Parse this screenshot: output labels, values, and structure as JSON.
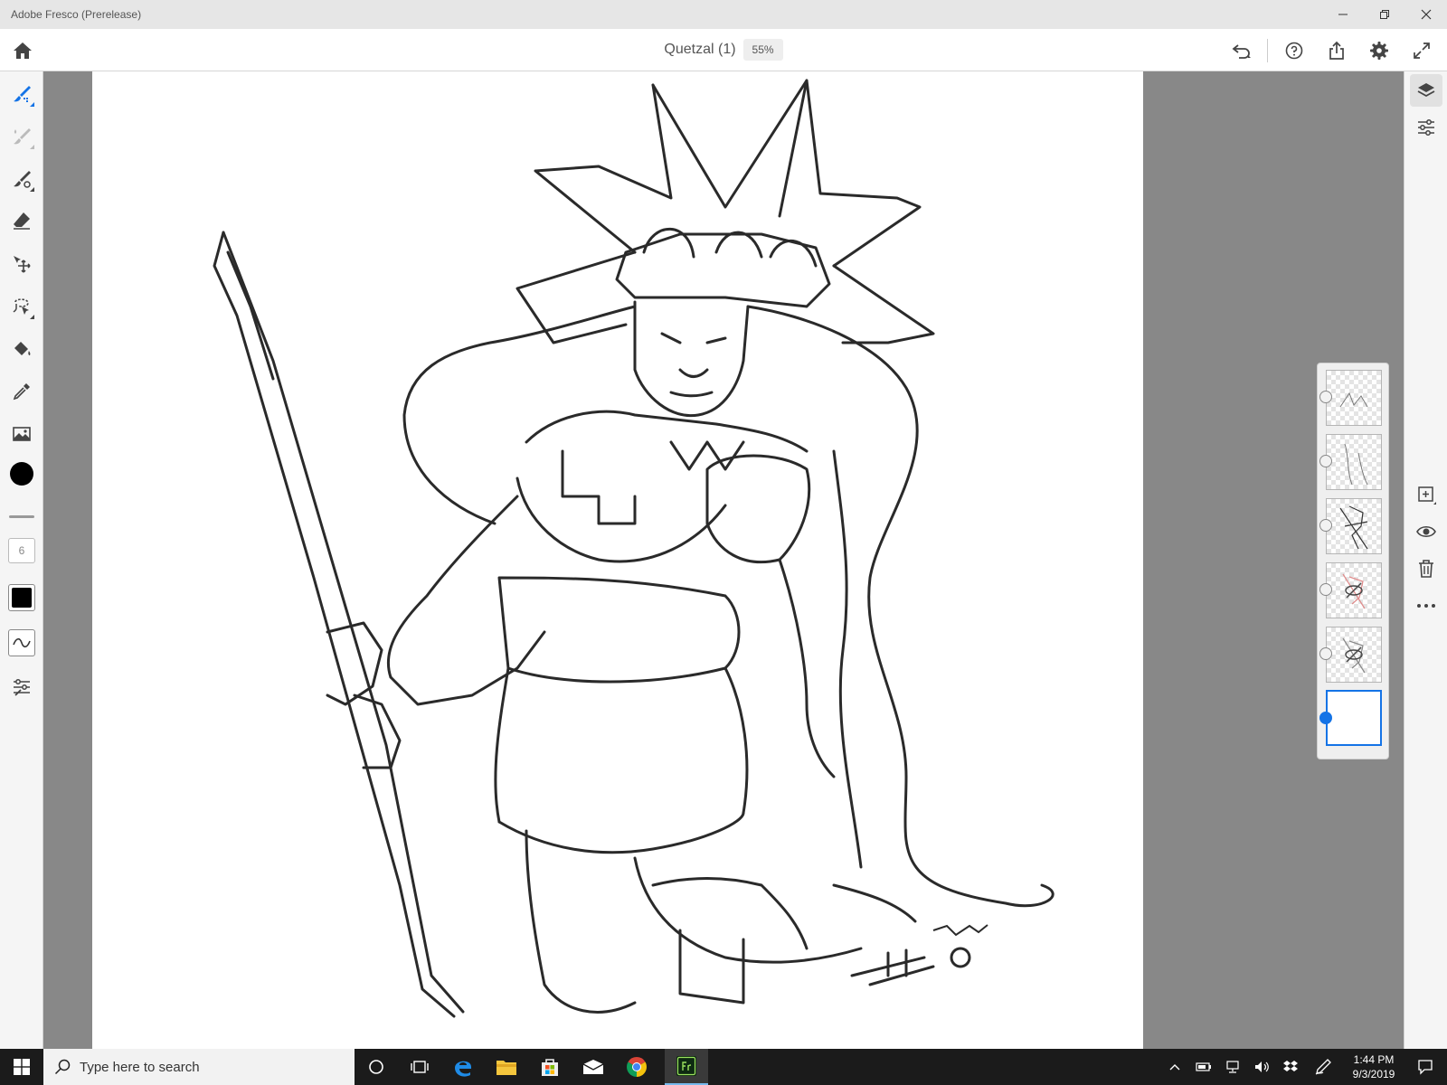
{
  "window": {
    "title": "Adobe Fresco (Prerelease)"
  },
  "header": {
    "document_name": "Quetzal (1)",
    "zoom": "55%"
  },
  "left_toolbar": {
    "tools": [
      "pixel-brush",
      "live-brush",
      "vector-brush",
      "eraser",
      "transform",
      "selection",
      "fill",
      "eyedropper",
      "image"
    ],
    "active_tool": "pixel-brush",
    "color": "#000000",
    "brush_size": "6"
  },
  "layers": {
    "count": 6,
    "selected_index": 5
  },
  "colors": {
    "accent": "#1473e6",
    "workspace": "#888888",
    "taskbar": "#1b1b1b"
  },
  "taskbar": {
    "search_placeholder": "Type here to search",
    "time": "1:44 PM",
    "date": "9/3/2019"
  }
}
